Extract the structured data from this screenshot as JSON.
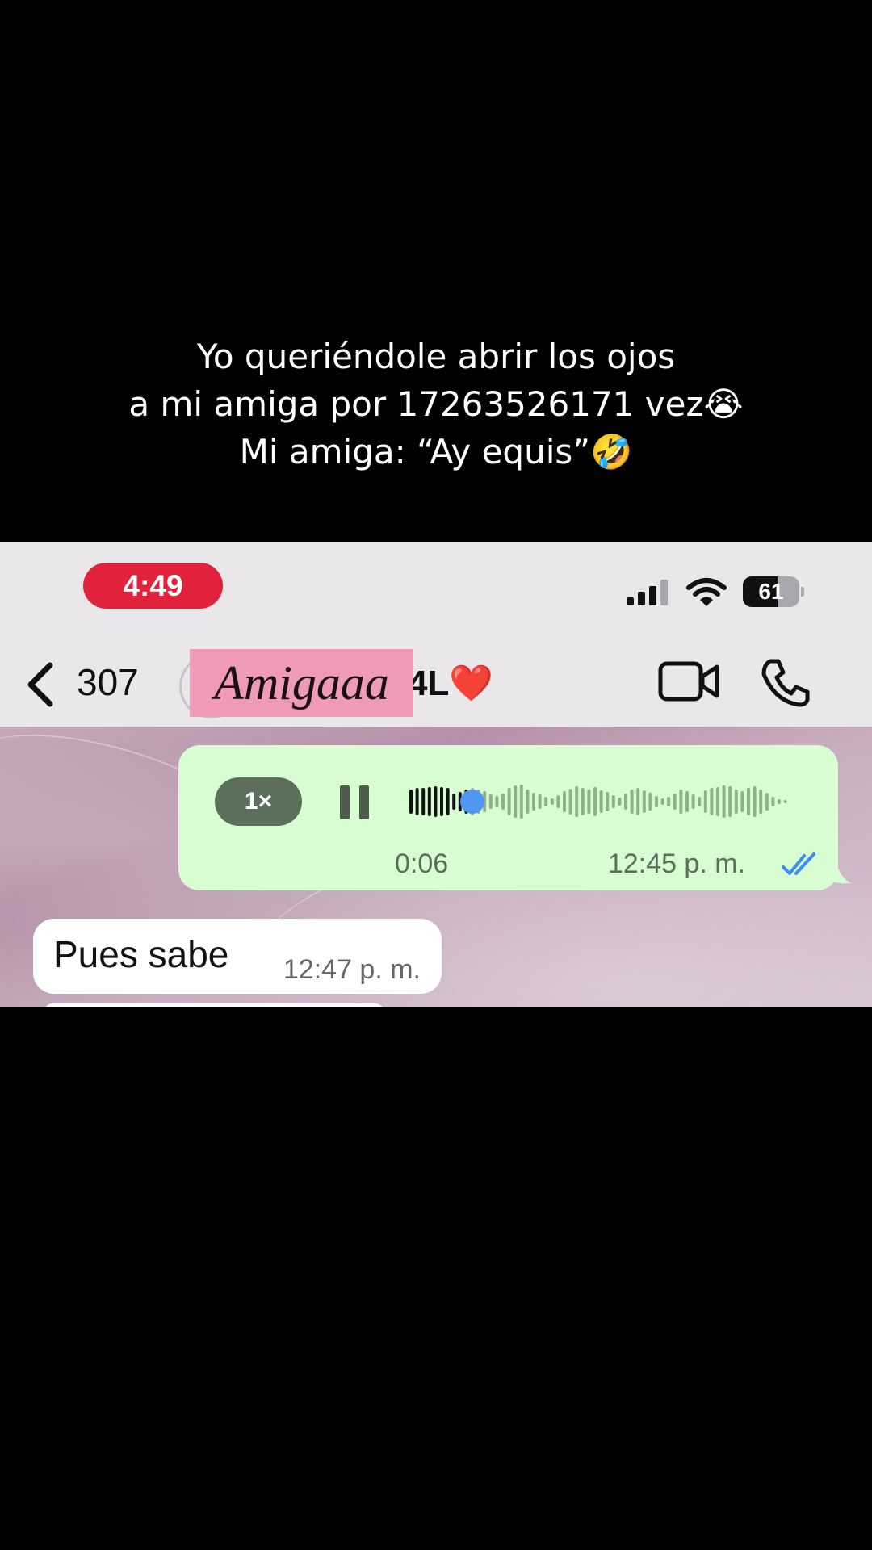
{
  "overlay_caption": {
    "line1": "Yo  queriéndole abrir los ojos",
    "line2": "a mi amiga por 17263526171 vez😭",
    "line3": "Mi amiga: “Ay equis”🤣"
  },
  "status_bar": {
    "time": "4:49",
    "battery_level": "61",
    "battery_fraction": 0.61,
    "time_pill_color": "#e2223a"
  },
  "nav_bar": {
    "back_icon": "chevron-left-icon",
    "unread_count": "307",
    "contact_name_sticker": "Amigaaa",
    "contact_name_visible_tail": "4L❤️",
    "video_icon": "video-camera-icon",
    "call_icon": "phone-icon"
  },
  "messages": [
    {
      "type": "voice",
      "direction": "outgoing",
      "playback_speed": "1×",
      "state": "playing",
      "duration": "0:06",
      "time": "12:45 p. m.",
      "status": "read",
      "bubble_color": "#d8fdd2",
      "progress_fraction": 0.16
    },
    {
      "type": "text",
      "direction": "incoming",
      "text": "Pues sabe",
      "time": "12:47 p. m."
    }
  ],
  "colors": {
    "read_receipt": "#3b8df0",
    "playhead": "#4f97f0"
  }
}
